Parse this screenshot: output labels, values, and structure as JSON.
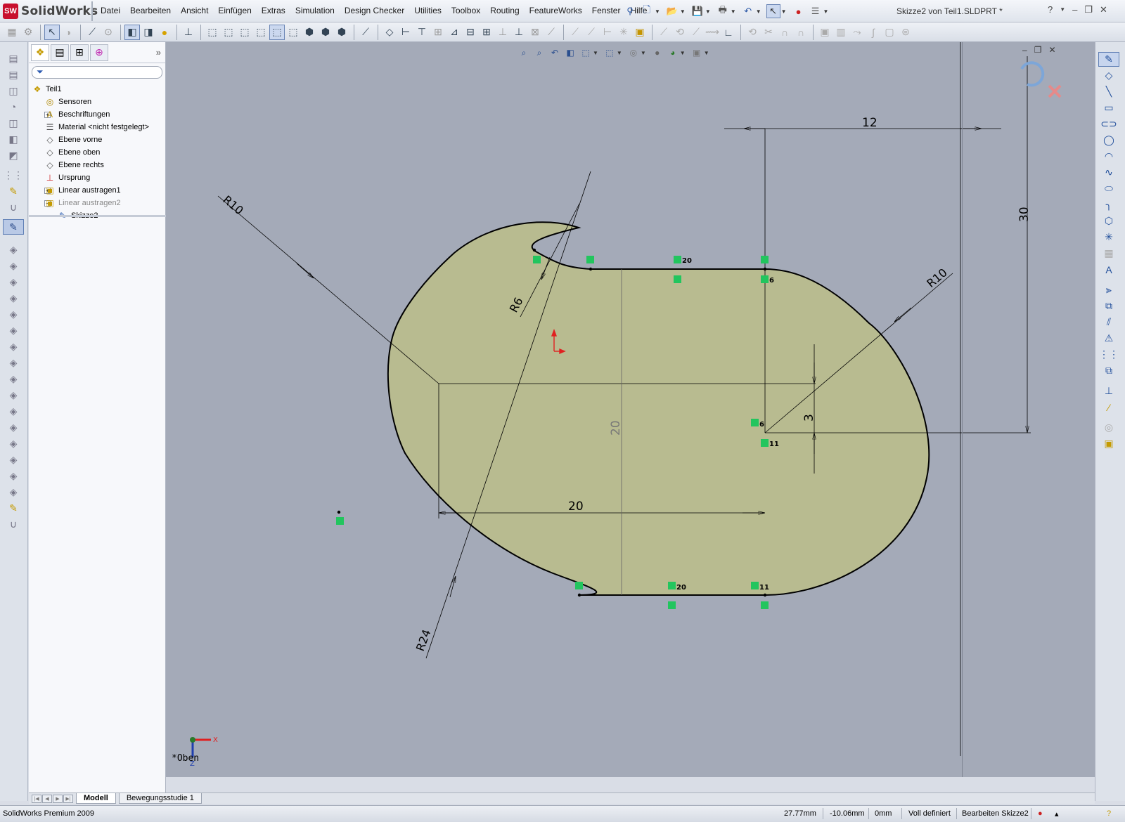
{
  "app": {
    "name": "SolidWorks",
    "logo_text": "SW",
    "document_title": "Skizze2 von Teil1.SLDPRT *"
  },
  "menu": [
    "Datei",
    "Bearbeiten",
    "Ansicht",
    "Einfügen",
    "Extras",
    "Simulation",
    "Design Checker",
    "Utilities",
    "Toolbox",
    "Routing",
    "FeatureWorks",
    "Fenster",
    "Hilfe"
  ],
  "window_controls": {
    "help": "?",
    "minimize": "–",
    "restore": "❐",
    "close": "✕"
  },
  "feature_tree": {
    "items": [
      {
        "label": "Teil1",
        "icon": "part-icon",
        "level": 0,
        "expander": ""
      },
      {
        "label": "Sensoren",
        "icon": "sensor-icon",
        "level": 1,
        "expander": ""
      },
      {
        "label": "Beschriftungen",
        "icon": "annotation-icon",
        "level": 1,
        "expander": "+"
      },
      {
        "label": "Material <nicht festgelegt>",
        "icon": "material-icon",
        "level": 1,
        "expander": ""
      },
      {
        "label": "Ebene vorne",
        "icon": "plane-icon",
        "level": 1,
        "expander": ""
      },
      {
        "label": "Ebene oben",
        "icon": "plane-icon",
        "level": 1,
        "expander": ""
      },
      {
        "label": "Ebene rechts",
        "icon": "plane-icon",
        "level": 1,
        "expander": ""
      },
      {
        "label": "Ursprung",
        "icon": "origin-icon",
        "level": 1,
        "expander": ""
      },
      {
        "label": "Linear austragen1",
        "icon": "extrude-icon",
        "level": 1,
        "expander": "+"
      },
      {
        "label": "Linear austragen2",
        "icon": "extrude-icon",
        "level": 1,
        "expander": "−",
        "dim": true
      },
      {
        "label": "Skizze2",
        "icon": "sketch-icon",
        "level": 2,
        "expander": ""
      }
    ]
  },
  "sketch": {
    "dimensions": {
      "top_width": "12",
      "right_height": "30",
      "r_left": "R10",
      "r_right": "R10",
      "r_small": "R6",
      "r_large": "R24",
      "bottom_width": "20",
      "inner_height": "20",
      "offset": "3"
    },
    "relation_numbers": {
      "top_slot": "20",
      "top_end": "6",
      "mid_left": "6",
      "mid_low": "11",
      "bottom_slot": "20",
      "bottom_end": "11"
    },
    "view_name": "*Oben",
    "triad_x": "X",
    "triad_z": "Z",
    "colors": {
      "fill": "#b8bb90",
      "background": "#a4aab8",
      "relation": "#22c55e",
      "origin": "#e02020"
    }
  },
  "bottom_tabs": {
    "model": "Modell",
    "motion": "Bewegungsstudie 1"
  },
  "status": {
    "product": "SolidWorks Premium 2009",
    "x": "27.77mm",
    "y": "-10.06mm",
    "z": "0mm",
    "state": "Voll definiert",
    "mode": "Bearbeiten Skizze2"
  }
}
